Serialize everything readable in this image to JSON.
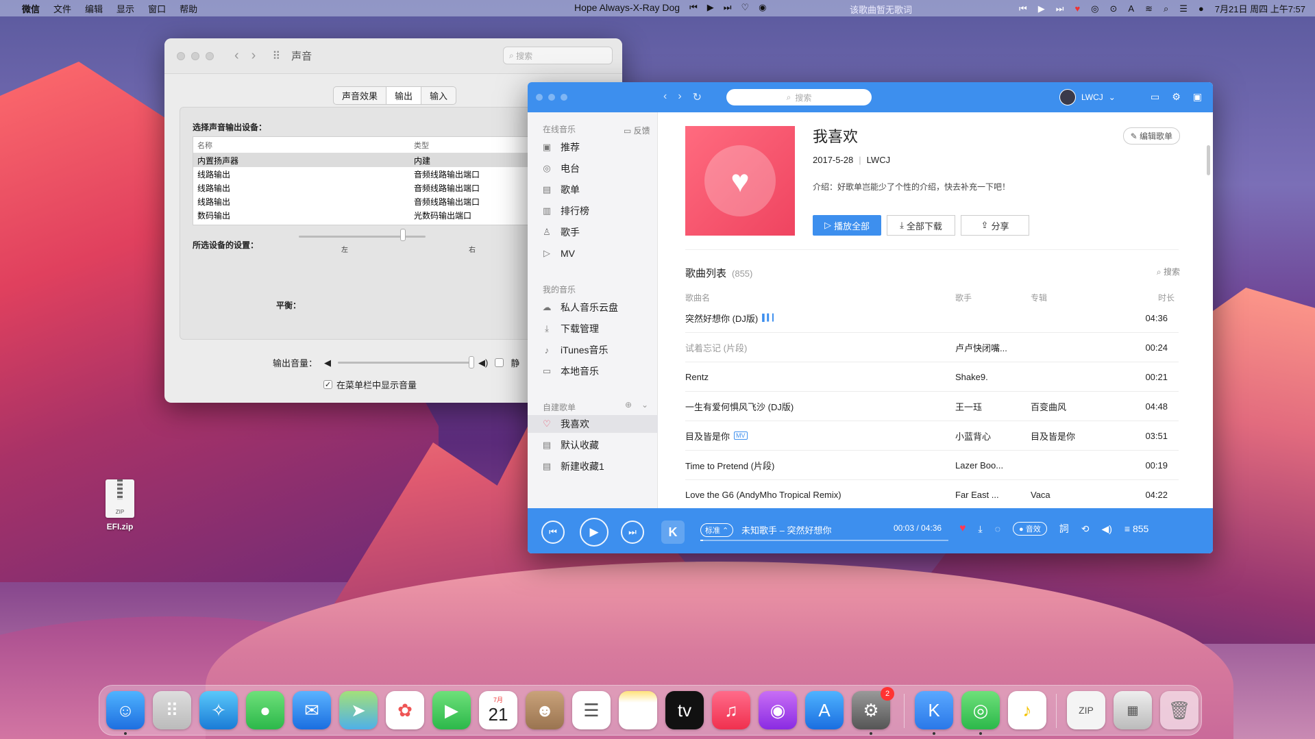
{
  "menubar": {
    "app_name": "微信",
    "menus": [
      "文件",
      "编辑",
      "显示",
      "窗口",
      "帮助"
    ],
    "now_playing": "Hope Always-X-Ray Dog",
    "lyric_text": "该歌曲暂无歌词",
    "datetime": "7月21日 周四 上午7:57"
  },
  "sound_window": {
    "title": "声音",
    "search_placeholder": "搜索",
    "tabs": [
      "声音效果",
      "输出",
      "输入"
    ],
    "active_tab": "输出",
    "select_device_label": "选择声音输出设备：",
    "table_headers": [
      "名称",
      "类型"
    ],
    "devices": [
      {
        "name": "内置扬声器",
        "type": "内建"
      },
      {
        "name": "线路输出",
        "type": "音频线路输出端口"
      },
      {
        "name": "线路输出",
        "type": "音频线路输出端口"
      },
      {
        "name": "线路输出",
        "type": "音频线路输出端口"
      },
      {
        "name": "数码输出",
        "type": "光数码输出端口"
      }
    ],
    "selected_device_settings_label": "所选设备的设置：",
    "balance_label": "平衡：",
    "balance_left": "左",
    "balance_right": "右",
    "balance_value": 0.5,
    "output_volume_label": "输出音量：",
    "output_volume_value": 1.0,
    "mute_label": "静",
    "show_in_menubar_label": "在菜单栏中显示音量",
    "show_in_menubar_checked": true
  },
  "kugou": {
    "search_placeholder": "搜索",
    "username": "LWCJ",
    "sidebar": {
      "online_section": "在线音乐",
      "feedback": "反馈",
      "online_items": [
        "推荐",
        "电台",
        "歌单",
        "排行榜",
        "歌手",
        "MV"
      ],
      "my_section": "我的音乐",
      "my_items": [
        "私人音乐云盘",
        "下载管理",
        "iTunes音乐",
        "本地音乐"
      ],
      "created_section": "自建歌单",
      "created_items": [
        "我喜欢",
        "默认收藏",
        "新建收藏1"
      ]
    },
    "playlist": {
      "title": "我喜欢",
      "date": "2017-5-28",
      "owner": "LWCJ",
      "intro": "介绍：好歌单岂能少了个性的介绍，快去补充一下吧！",
      "edit_label": "编辑歌单",
      "play_all": "播放全部",
      "download_all": "全部下载",
      "share": "分享",
      "list_title": "歌曲列表",
      "list_count": "(855)",
      "list_search": "搜索",
      "columns": [
        "歌曲名",
        "歌手",
        "专辑",
        "时长"
      ],
      "songs": [
        {
          "name": "突然好想你 (DJ版)",
          "artist": "",
          "album": "",
          "duration": "04:36",
          "badge": "bars"
        },
        {
          "name": "试着忘记 (片段)",
          "artist": "卢卢快闭嘴...",
          "album": "",
          "duration": "00:24",
          "badge": ""
        },
        {
          "name": "Rentz",
          "artist": "Shake9.",
          "album": "",
          "duration": "00:21",
          "badge": ""
        },
        {
          "name": "一生有爱何惧风飞沙 (DJ版)",
          "artist": "王一珏",
          "album": "百变曲风",
          "duration": "04:48",
          "badge": ""
        },
        {
          "name": "目及皆是你",
          "artist": "小蓝背心",
          "album": "目及皆是你",
          "duration": "03:51",
          "badge": "MV"
        },
        {
          "name": "Time to Pretend (片段)",
          "artist": "Lazer Boo...",
          "album": "",
          "duration": "00:19",
          "badge": ""
        },
        {
          "name": "Love the G6 (AndyMho Tropical Remix)",
          "artist": "Far East ...",
          "album": "Vaca",
          "duration": "04:22",
          "badge": ""
        }
      ]
    },
    "player": {
      "quality": "标准",
      "now_playing": "未知歌手 – 突然好想你",
      "current_time": "00:03",
      "total_time": "04:36",
      "progress": 0.011,
      "fx_label": "音效",
      "queue_count": "855"
    }
  },
  "desktop": {
    "file_name": "EFI.zip",
    "file_icon_label": "ZIP"
  },
  "dock": {
    "calendar_month": "7月",
    "calendar_day": "21",
    "settings_badge": "2"
  }
}
